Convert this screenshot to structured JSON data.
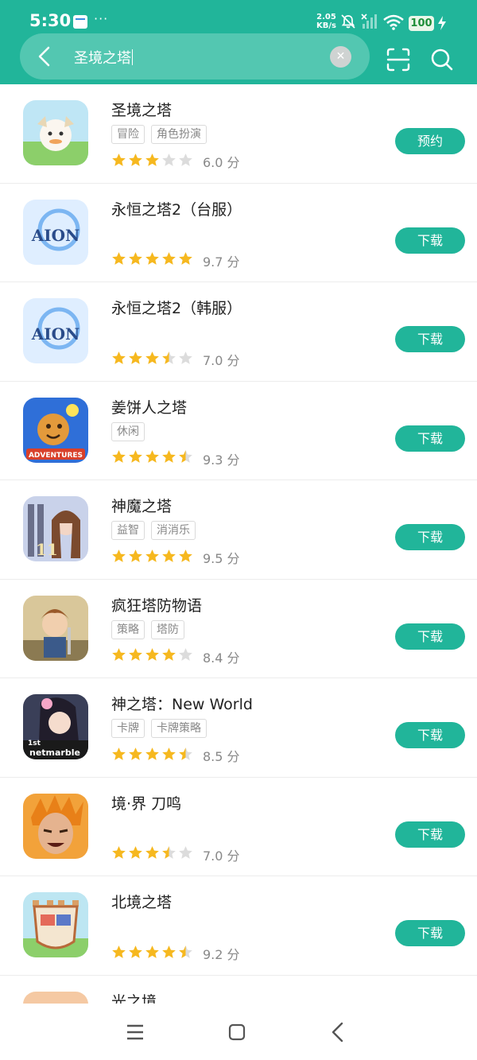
{
  "status": {
    "time": "5:30",
    "dots": "···",
    "speed_value": "2.05",
    "speed_unit": "KB/s",
    "battery": "100"
  },
  "search": {
    "query": "圣境之塔"
  },
  "colors": {
    "accent": "#21b59a",
    "search_bg": "#53c7b1",
    "star": "#f6b81f",
    "star_empty": "#dcdcdc"
  },
  "apps": [
    {
      "name": "圣境之塔",
      "tags": [
        "冒险",
        "角色扮演"
      ],
      "stars": 3,
      "score": "6.0 分",
      "button": "预约"
    },
    {
      "name": "永恒之塔2（台服）",
      "tags": [],
      "stars": 5,
      "score": "9.7 分",
      "button": "下载"
    },
    {
      "name": "永恒之塔2（韩服）",
      "tags": [],
      "stars": 3.5,
      "score": "7.0 分",
      "button": "下载"
    },
    {
      "name": "姜饼人之塔",
      "tags": [
        "休闲"
      ],
      "stars": 4.5,
      "score": "9.3 分",
      "button": "下载"
    },
    {
      "name": "神魔之塔",
      "tags": [
        "益智",
        "消消乐"
      ],
      "stars": 5,
      "score": "9.5 分",
      "button": "下载"
    },
    {
      "name": "疯狂塔防物语",
      "tags": [
        "策略",
        "塔防"
      ],
      "stars": 4,
      "score": "8.4 分",
      "button": "下载"
    },
    {
      "name": "神之塔：New World",
      "tags": [
        "卡牌",
        "卡牌策略"
      ],
      "stars": 4.5,
      "score": "8.5 分",
      "button": "下载"
    },
    {
      "name": "境·界 刀鸣",
      "tags": [],
      "stars": 3.5,
      "score": "7.0 分",
      "button": "下载"
    },
    {
      "name": "北境之塔",
      "tags": [],
      "stars": 4.5,
      "score": "9.2 分",
      "button": "下载"
    },
    {
      "name": "光之境",
      "tags": [],
      "stars": 0,
      "score": "",
      "button": ""
    }
  ]
}
